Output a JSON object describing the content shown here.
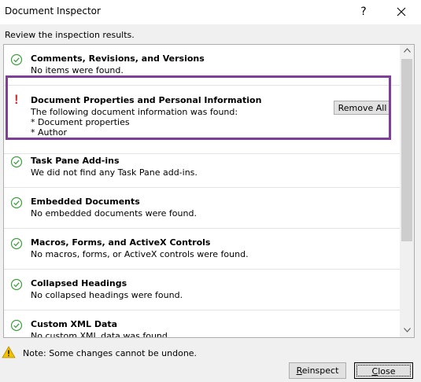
{
  "window": {
    "title": "Document Inspector",
    "help_label": "?"
  },
  "subtitle": "Review the inspection results.",
  "results": [
    {
      "title": "Comments, Revisions, and Versions",
      "status": "ok",
      "description": "No items were found."
    },
    {
      "title": "Document Properties and Personal Information",
      "status": "issue",
      "description": "The following document information was found:\n* Document properties\n* Author",
      "action_label": "Remove All"
    },
    {
      "title": "Task Pane Add-ins",
      "status": "ok",
      "description": "We did not find any Task Pane add-ins."
    },
    {
      "title": "Embedded Documents",
      "status": "ok",
      "description": "No embedded documents were found."
    },
    {
      "title": "Macros, Forms, and ActiveX Controls",
      "status": "ok",
      "description": "No macros, forms, or ActiveX controls were found."
    },
    {
      "title": "Collapsed Headings",
      "status": "ok",
      "description": "No collapsed headings were found."
    },
    {
      "title": "Custom XML Data",
      "status": "ok",
      "description": "No custom XML data was found."
    }
  ],
  "note": "Note: Some changes cannot be undone.",
  "buttons": {
    "reinspect": "Reinspect",
    "close": "Close"
  },
  "colors": {
    "ok_icon": "#3f9f3f",
    "issue_icon": "#d13438",
    "highlight": "#7f3f98",
    "warning": "#f2c200"
  }
}
